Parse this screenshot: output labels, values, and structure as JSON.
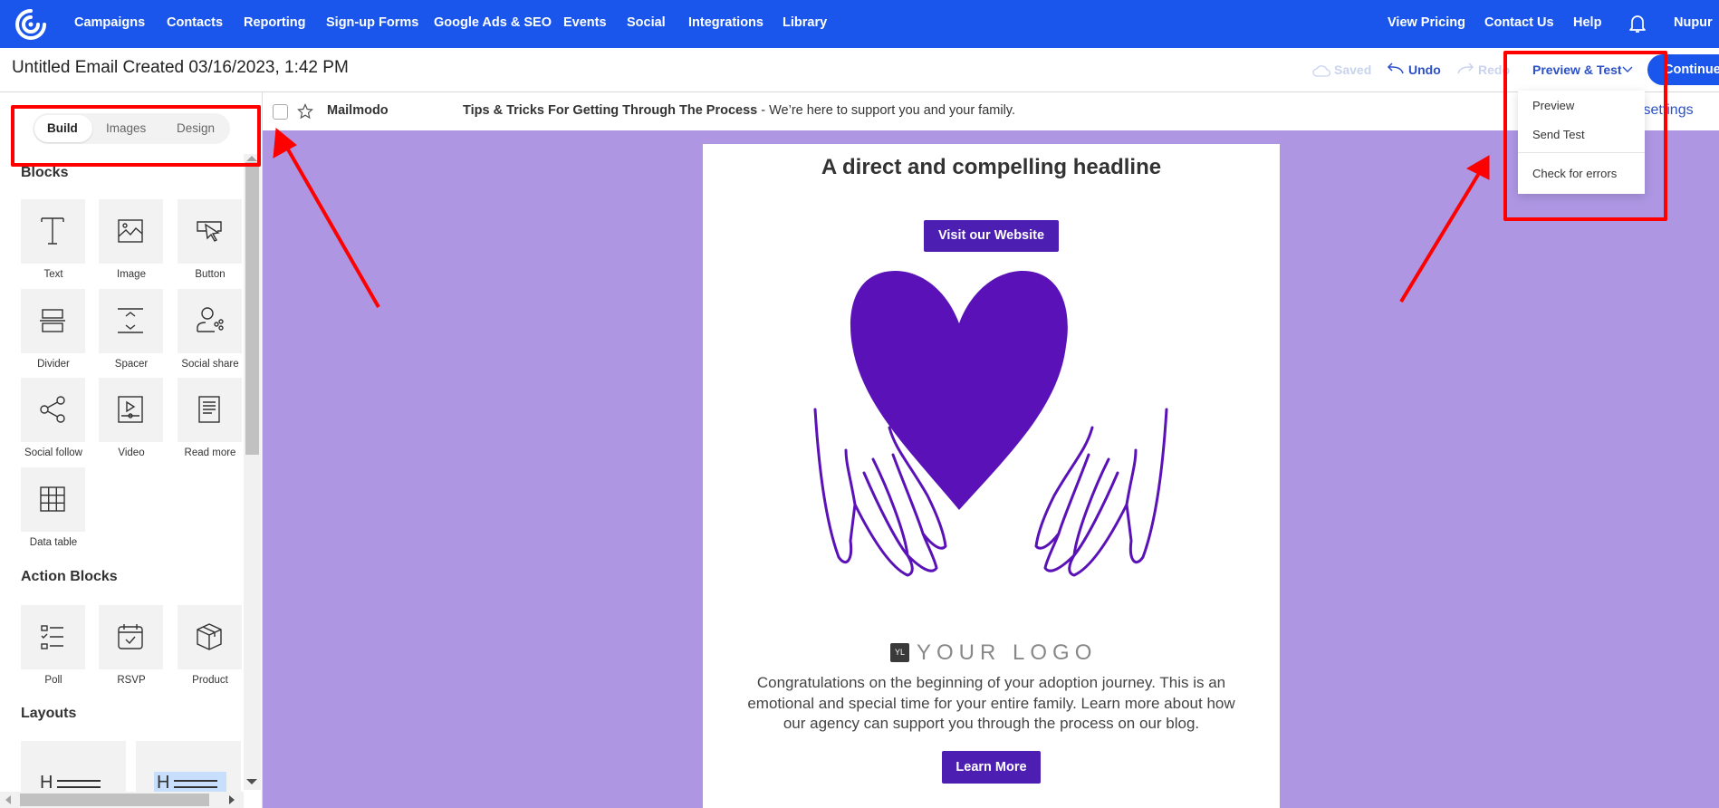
{
  "colors": {
    "nav": "#1a56eb",
    "canvas": "#ae96e3",
    "accent_purple": "#4c1fb2",
    "heart": "#5a12b8",
    "annotation_red": "#ff0000"
  },
  "nav": {
    "logo_icon": "constant-contact-logo",
    "items": [
      "Campaigns",
      "Contacts",
      "Reporting",
      "Sign-up Forms",
      "Google Ads & SEO",
      "Events",
      "Social",
      "Integrations",
      "Library"
    ],
    "right": [
      "View Pricing",
      "Contact Us",
      "Help"
    ],
    "bell_icon": "bell-icon",
    "user": "Nupur"
  },
  "toolbar": {
    "title": "Untitled Email Created 03/16/2023, 1:42 PM",
    "saved": "Saved",
    "undo": "Undo",
    "redo": "Redo",
    "preview_test": "Preview & Test",
    "continue": "Continue"
  },
  "dropdown": {
    "items": [
      "Preview",
      "Send Test",
      "Check for errors"
    ]
  },
  "subject_row": {
    "sender": "Mailmodo",
    "subject": "Tips & Tricks For Getting Through The Process",
    "preheader": " - We’re here to support you and your family.",
    "settings_link": "Email settings"
  },
  "sidebar": {
    "tabs": [
      "Build",
      "Images",
      "Design"
    ],
    "active_tab": "Build",
    "blocks_heading": "Blocks",
    "blocks": [
      {
        "label": "Text",
        "icon": "text"
      },
      {
        "label": "Image",
        "icon": "image"
      },
      {
        "label": "Button",
        "icon": "button"
      },
      {
        "label": "Divider",
        "icon": "divider"
      },
      {
        "label": "Spacer",
        "icon": "spacer"
      },
      {
        "label": "Social share",
        "icon": "social-share"
      },
      {
        "label": "Social follow",
        "icon": "social-follow"
      },
      {
        "label": "Video",
        "icon": "video"
      },
      {
        "label": "Read more",
        "icon": "read-more"
      },
      {
        "label": "Data table",
        "icon": "data-table"
      }
    ],
    "action_heading": "Action Blocks",
    "actions": [
      {
        "label": "Poll",
        "icon": "poll"
      },
      {
        "label": "RSVP",
        "icon": "rsvp"
      },
      {
        "label": "Product",
        "icon": "product"
      }
    ],
    "layouts_heading": "Layouts",
    "layout_glyph": "H"
  },
  "email": {
    "headline": "A direct and compelling headline",
    "visit_button": "Visit our Website",
    "logo_badge": "YL",
    "logo_text": "YOUR LOGO",
    "paragraph_lines": [
      "Congratulations on the beginning of your adoption journey. This is an",
      "emotional and special time for your entire family. Learn more about how",
      "our agency can support you through the process on our blog."
    ],
    "learn_button": "Learn More"
  }
}
